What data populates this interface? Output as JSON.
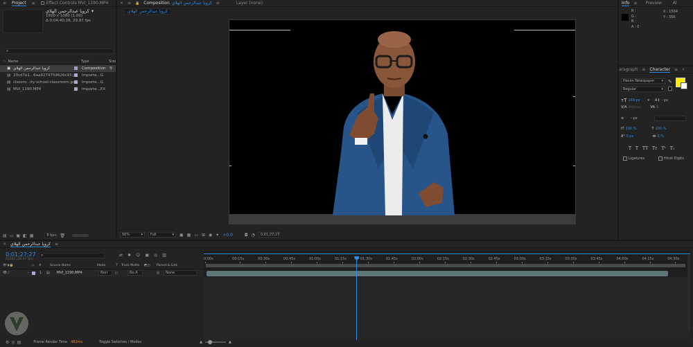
{
  "project": {
    "tab_project": "Project",
    "tab_effect_controls": "Effect Controls MVI_1190.MP4",
    "comp_name": "كرويا عبدالرحمن الهلاي",
    "comp_res": "1920 x 1080 (1.00)",
    "comp_duration": "Δ 0;04;40;28, 29.97 fps",
    "col_name": "Name",
    "col_type": "Type",
    "col_size": "Size",
    "items": [
      {
        "name": "كرويا عبدالرحمن الهلاي",
        "type": "Composition",
        "color": "#9e9ece",
        "selected": true
      },
      {
        "name": "20cd7e1...6aa9274759626c93.jpg",
        "type": "Importe...G",
        "color": "#a9a9d7",
        "selected": false
      },
      {
        "name": "classro...ity-school-classroom.jpg",
        "type": "Importe...G",
        "color": "#a9a9d7",
        "selected": false
      },
      {
        "name": "MVI_1190.MP4",
        "type": "Importe...EX",
        "color": "#a9a9d7",
        "selected": false
      }
    ],
    "bpc": "8 bpc"
  },
  "composition": {
    "tab_label": "Composition",
    "comp_name": "كرويا عبدالرحمن الهلاي",
    "layer_tab": "Layer (none)",
    "sub_tab": "كرويا عبدالرحمن الهلاي",
    "zoom": "50%",
    "resolution": "Full",
    "exposure": "+0.0",
    "timecode": "0;01;27;27"
  },
  "info": {
    "tab_info": "Info",
    "tab_preview": "Preview",
    "tab_ai": "Al",
    "r": "R :",
    "g": "G :",
    "b": "B :",
    "a": "A : 0",
    "x": "X : 1504",
    "y": "Y : 350"
  },
  "character": {
    "tab_paragraph": "aragraph",
    "tab_character": "Character",
    "font": "Hacen Newspaper",
    "style": "Regular",
    "size": "169 px",
    "leading": "- px",
    "kerning": "Metrics",
    "tracking": "0",
    "kerning_right": "0 px",
    "stroke_width": "- px",
    "vscale": "100 %",
    "hscale": "100 %",
    "baseline": "0 px",
    "tsume": "0 %",
    "fill_color": "#ffec00",
    "ligatures": "Ligatures",
    "hindi": "Hindi Digits",
    "styles": [
      "T",
      "T",
      "TT",
      "Tт",
      "T¹",
      "T₁"
    ]
  },
  "timeline": {
    "tab_label": "كرويا عبدالرحمن الهلاي",
    "timecode": "0;01;27;27",
    "fps_note": "02650 (29.97 fps)",
    "col_source": "Source Name",
    "col_mode": "Mode",
    "col_t": "T",
    "col_trackmatte": "Track Matte",
    "col_parent": "Parent & Link",
    "layer": {
      "num": "1",
      "name": "MVI_1190.MP4",
      "mode": "Norr",
      "matte": "No A",
      "parent": "None"
    },
    "ruler": [
      "0:00s",
      "00:15s",
      "00:30s",
      "00:45s",
      "01:00s",
      "01:15s",
      "01:30s",
      "01:45s",
      "02:00s",
      "02:15s",
      "02:30s",
      "02:45s",
      "03:00s",
      "03:15s",
      "03:30s",
      "03:45s",
      "04:00s",
      "04:15s",
      "04:30s"
    ],
    "playhead_pct": 31.4,
    "render_label": "Frame Render Time",
    "render_value": "482ms",
    "toggle_label": "Toggle Switches / Modes"
  },
  "colors": {
    "accent": "#2d8ceb",
    "render_time": "#e68a2e",
    "track": "#5f7577"
  }
}
